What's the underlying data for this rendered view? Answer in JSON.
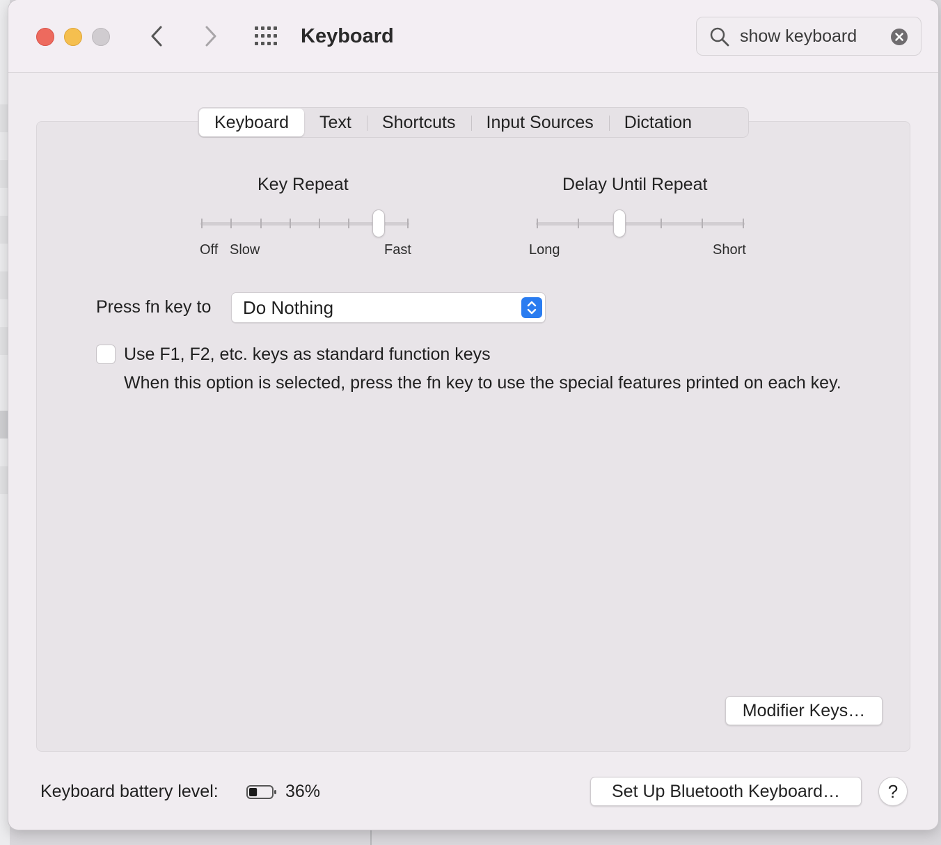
{
  "window": {
    "title": "Keyboard",
    "search": {
      "value": "show keyboard"
    }
  },
  "tabs": [
    {
      "label": "Keyboard",
      "active": true
    },
    {
      "label": "Text"
    },
    {
      "label": "Shortcuts"
    },
    {
      "label": "Input Sources"
    },
    {
      "label": "Dictation"
    }
  ],
  "key_repeat": {
    "title": "Key Repeat",
    "labels": {
      "off": "Off",
      "slow": "Slow",
      "fast": "Fast"
    },
    "ticks": 8,
    "selected_step": 6
  },
  "delay_until_repeat": {
    "title": "Delay Until Repeat",
    "labels": {
      "long": "Long",
      "short": "Short"
    },
    "ticks": 6,
    "selected_step": 2
  },
  "fn_key": {
    "label": "Press fn key to",
    "value": "Do Nothing"
  },
  "function_keys": {
    "label": "Use F1, F2, etc. keys as standard function keys",
    "checked": false,
    "help": "When this option is selected, press the fn key to use the special features printed on each key."
  },
  "buttons": {
    "modifier_keys": "Modifier Keys…",
    "bluetooth": "Set Up Bluetooth Keyboard…",
    "help": "?"
  },
  "battery": {
    "label": "Keyboard battery level:",
    "percent_text": "36%",
    "level": 0.36
  },
  "colors": {
    "accent": "#2a7cf0",
    "close": "#ed6a5e",
    "minimize": "#f5bf4f"
  }
}
